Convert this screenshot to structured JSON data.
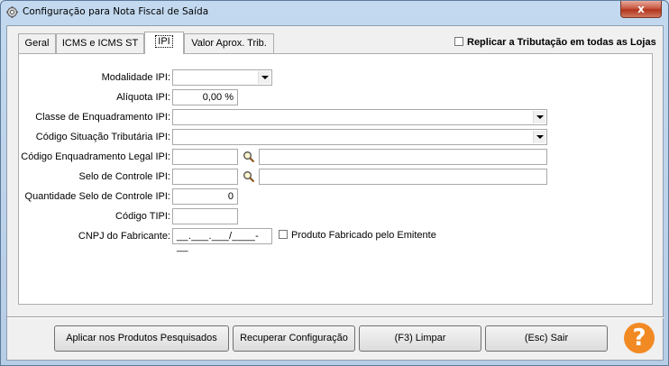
{
  "window": {
    "title": "Configuração para Nota Fiscal de Saída",
    "close_label": "x"
  },
  "tabs": [
    {
      "label": "Geral"
    },
    {
      "label": "ICMS e ICMS ST"
    },
    {
      "label": "IPI",
      "active": true
    },
    {
      "label": "Valor Aprox. Trib."
    }
  ],
  "replicar": {
    "label": "Replicar a Tributação em todas as Lojas",
    "checked": false
  },
  "form": {
    "modalidade_ipi": {
      "label": "Modalidade IPI:",
      "value": ""
    },
    "aliquota_ipi": {
      "label": "Alíquota IPI:",
      "value": "0,00 %"
    },
    "classe_enquadramento": {
      "label": "Classe de Enquadramento IPI:",
      "value": ""
    },
    "codigo_situacao": {
      "label": "Código Situação Tributária IPI:",
      "value": ""
    },
    "codigo_enquadramento_legal": {
      "label": "Código Enquadramento Legal IPI:",
      "code": "",
      "description": ""
    },
    "selo_controle": {
      "label": "Selo de Controle IPI:",
      "code": "",
      "description": ""
    },
    "quantidade_selo": {
      "label": "Quantidade Selo de Controle IPI:",
      "value": "0"
    },
    "codigo_tipi": {
      "label": "Código TIPI:",
      "value": ""
    },
    "cnpj_fabricante": {
      "label": "CNPJ do Fabricante:",
      "value": "__.___.___/____-__"
    },
    "produto_fabricado": {
      "label": "Produto Fabricado pelo Emitente",
      "checked": false
    }
  },
  "buttons": {
    "aplicar": "Aplicar nos Produtos Pesquisados",
    "recuperar": "Recuperar Configuração",
    "limpar": "(F3) Limpar",
    "sair": "(Esc) Sair",
    "help": "?"
  },
  "colors": {
    "help": "#f28a24",
    "close": "#c75b45"
  }
}
